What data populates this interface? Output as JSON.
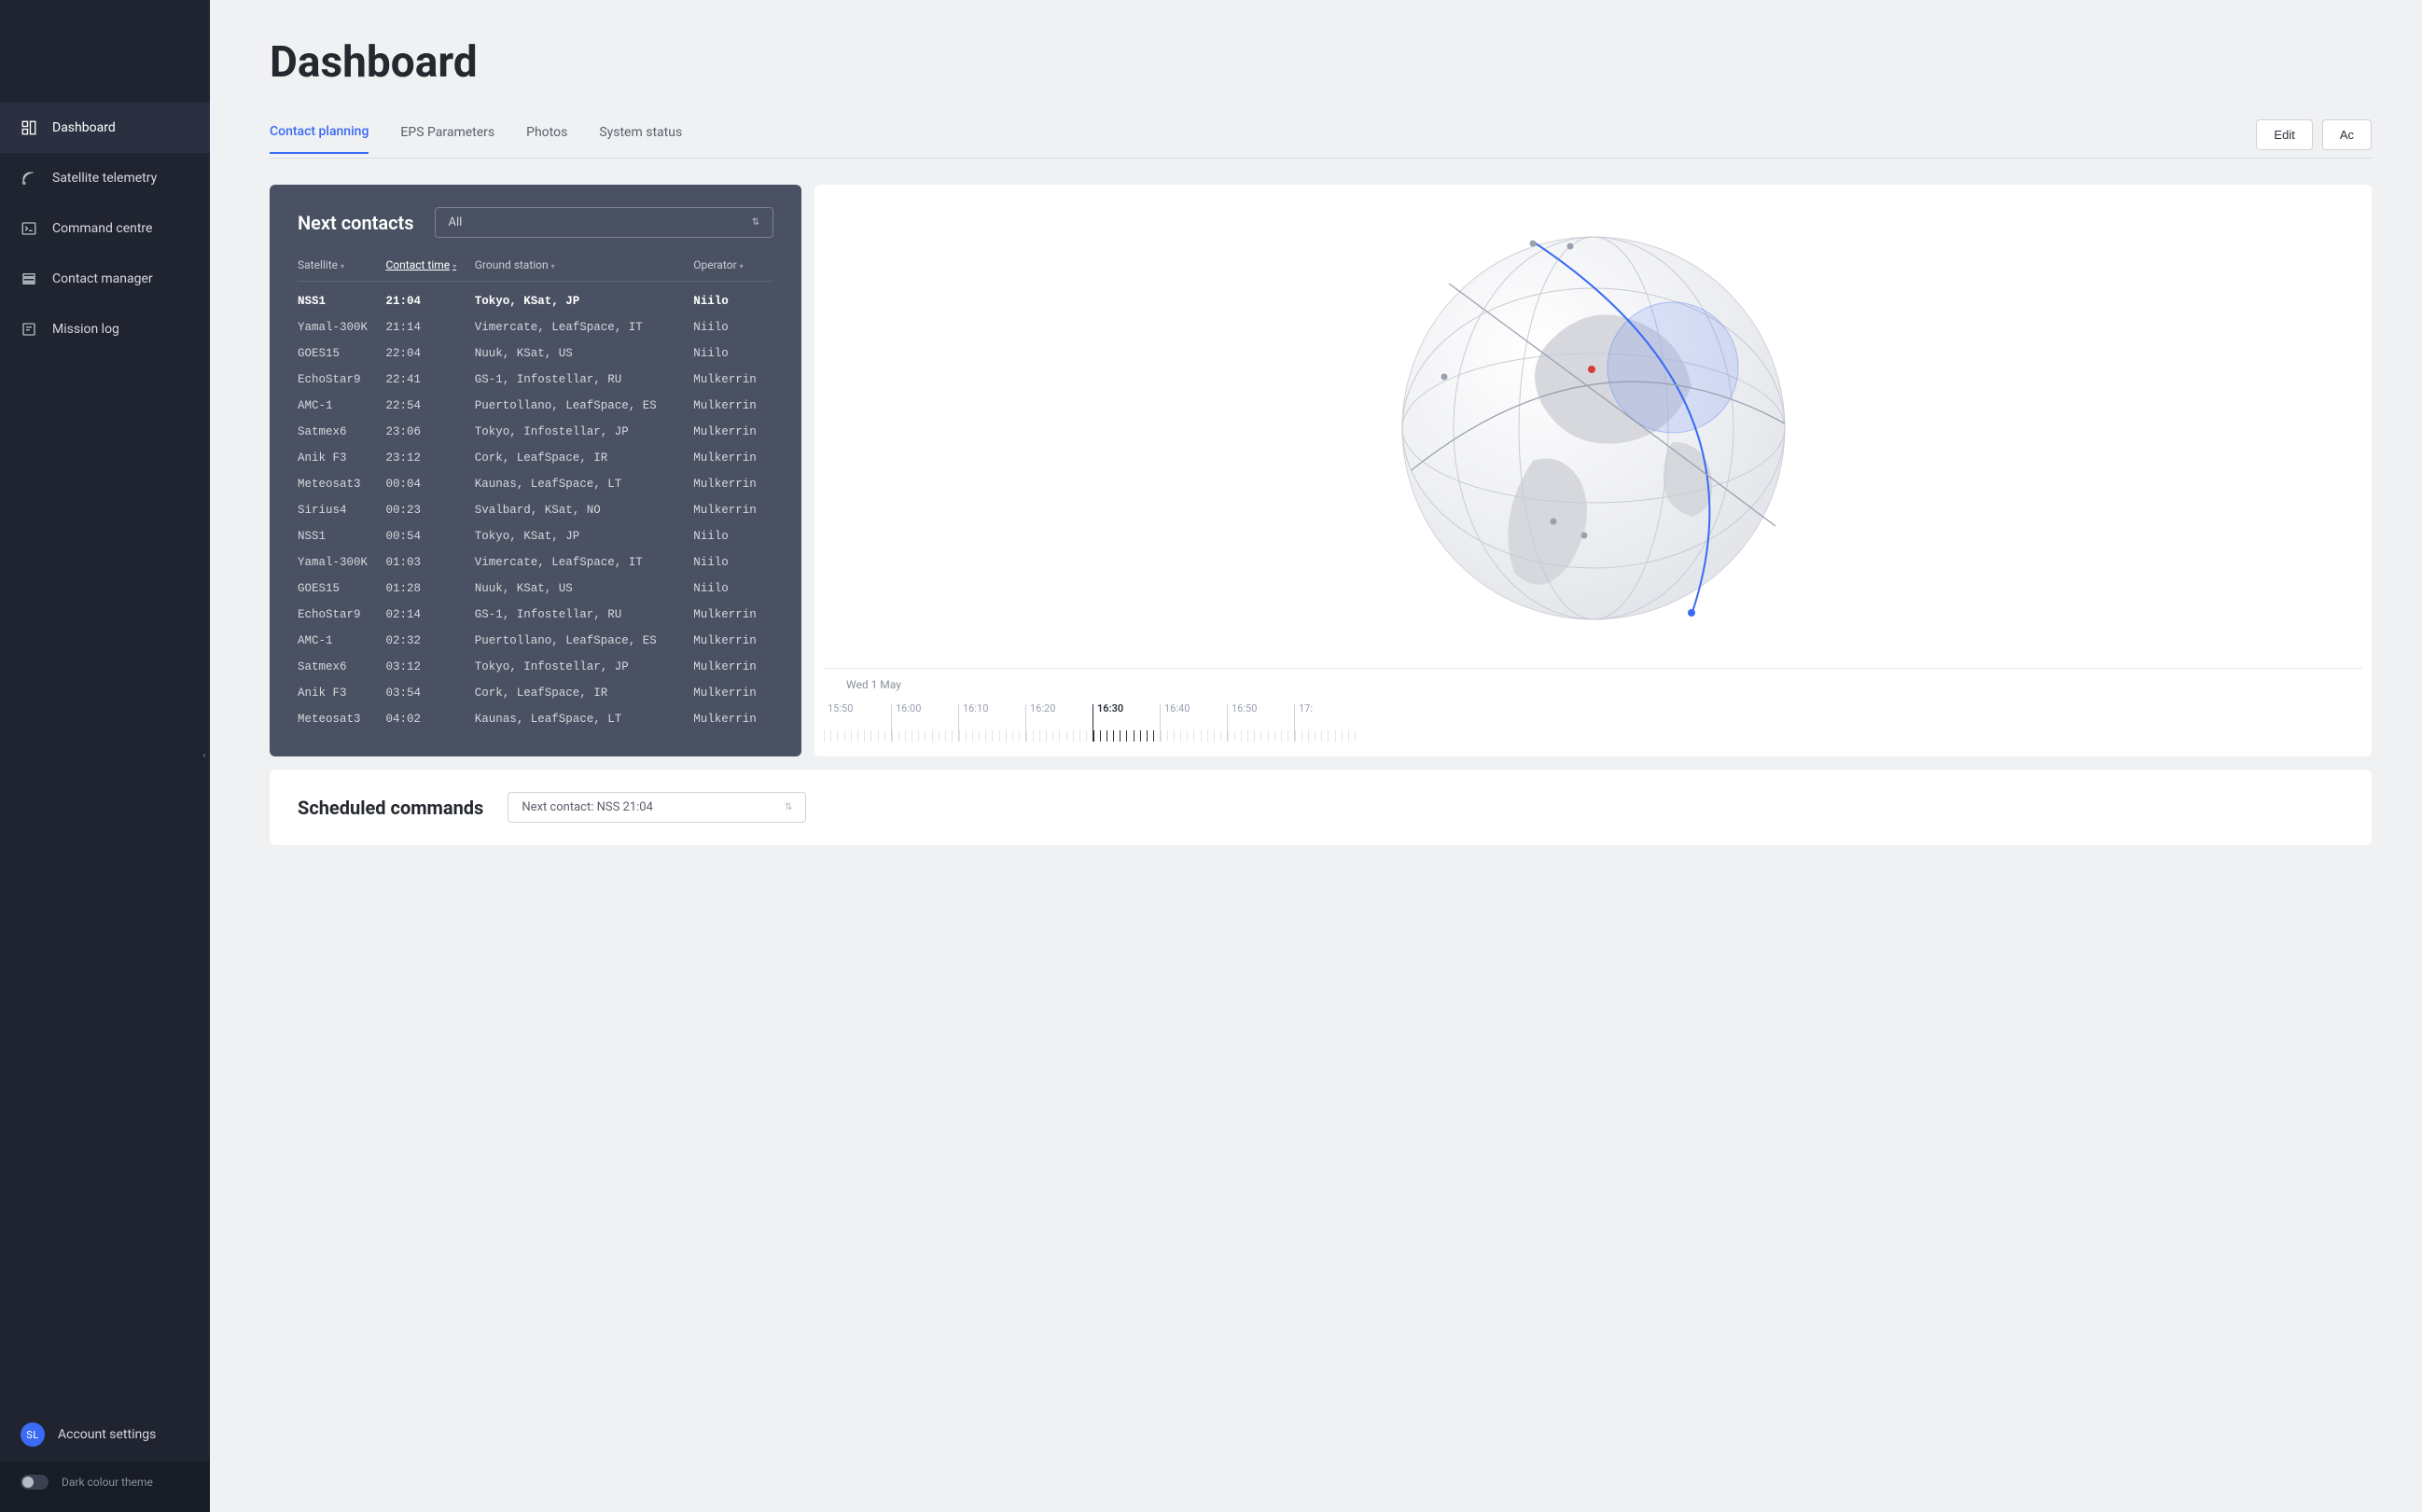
{
  "page": {
    "title": "Dashboard"
  },
  "sidebar": {
    "items": [
      {
        "label": "Dashboard"
      },
      {
        "label": "Satellite telemetry"
      },
      {
        "label": "Command centre"
      },
      {
        "label": "Contact manager"
      },
      {
        "label": "Mission log"
      }
    ],
    "account": {
      "initials": "SL",
      "label": "Account settings"
    },
    "theme": {
      "label": "Dark colour theme"
    }
  },
  "tabs": {
    "items": [
      {
        "label": "Contact planning"
      },
      {
        "label": "EPS Parameters"
      },
      {
        "label": "Photos"
      },
      {
        "label": "System status"
      }
    ],
    "actions": {
      "edit": "Edit",
      "add": "Ac"
    }
  },
  "contacts": {
    "title": "Next contacts",
    "filter_value": "All",
    "columns": {
      "satellite": "Satellite",
      "contact_time": "Contact time",
      "ground_station": "Ground station",
      "operator": "Operator"
    },
    "rows": [
      {
        "satellite": "NSS1",
        "time": "21:04",
        "station": "Tokyo, KSat, JP",
        "operator": "Niilo"
      },
      {
        "satellite": "Yamal-300K",
        "time": "21:14",
        "station": "Vimercate, LeafSpace, IT",
        "operator": "Niilo"
      },
      {
        "satellite": "GOES15",
        "time": "22:04",
        "station": "Nuuk, KSat, US",
        "operator": "Niilo"
      },
      {
        "satellite": "EchoStar9",
        "time": "22:41",
        "station": "GS-1, Infostellar, RU",
        "operator": "Mulkerrin"
      },
      {
        "satellite": "AMC-1",
        "time": "22:54",
        "station": "Puertollano, LeafSpace, ES",
        "operator": "Mulkerrin"
      },
      {
        "satellite": "Satmex6",
        "time": "23:06",
        "station": "Tokyo, Infostellar, JP",
        "operator": "Mulkerrin"
      },
      {
        "satellite": "Anik F3",
        "time": "23:12",
        "station": "Cork, LeafSpace, IR",
        "operator": "Mulkerrin"
      },
      {
        "satellite": "Meteosat3",
        "time": "00:04",
        "station": "Kaunas, LeafSpace, LT",
        "operator": "Mulkerrin"
      },
      {
        "satellite": "Sirius4",
        "time": "00:23",
        "station": "Svalbard, KSat, NO",
        "operator": "Mulkerrin"
      },
      {
        "satellite": "NSS1",
        "time": "00:54",
        "station": "Tokyo, KSat, JP",
        "operator": "Niilo"
      },
      {
        "satellite": "Yamal-300K",
        "time": "01:03",
        "station": "Vimercate, LeafSpace, IT",
        "operator": "Niilo"
      },
      {
        "satellite": "GOES15",
        "time": "01:28",
        "station": "Nuuk, KSat, US",
        "operator": "Niilo"
      },
      {
        "satellite": "EchoStar9",
        "time": "02:14",
        "station": "GS-1, Infostellar, RU",
        "operator": "Mulkerrin"
      },
      {
        "satellite": "AMC-1",
        "time": "02:32",
        "station": "Puertollano, LeafSpace, ES",
        "operator": "Mulkerrin"
      },
      {
        "satellite": "Satmex6",
        "time": "03:12",
        "station": "Tokyo, Infostellar, JP",
        "operator": "Mulkerrin"
      },
      {
        "satellite": "Anik F3",
        "time": "03:54",
        "station": "Cork, LeafSpace, IR",
        "operator": "Mulkerrin"
      },
      {
        "satellite": "Meteosat3",
        "time": "04:02",
        "station": "Kaunas, LeafSpace, LT",
        "operator": "Mulkerrin"
      }
    ]
  },
  "timeline": {
    "date": "Wed 1 May",
    "ticks": [
      "15:50",
      "16:00",
      "16:10",
      "16:20",
      "16:30",
      "16:40",
      "16:50",
      "17:"
    ],
    "now_index": 4
  },
  "scheduled": {
    "title": "Scheduled commands",
    "select_value": "Next contact: NSS 21:04"
  }
}
